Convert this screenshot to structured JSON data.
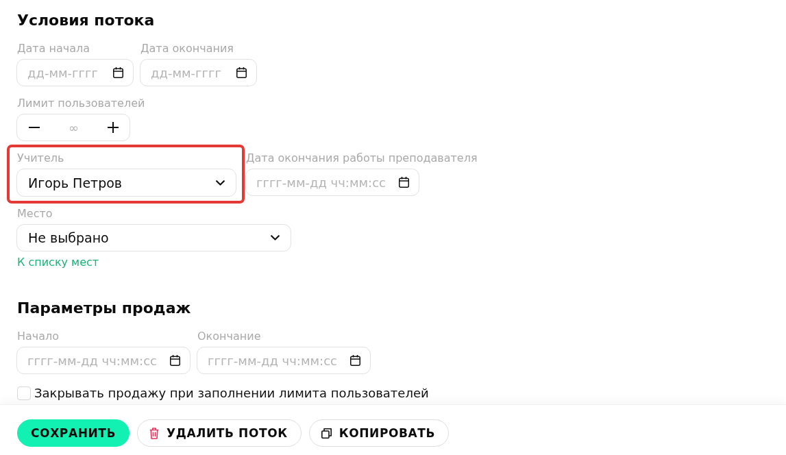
{
  "sections": [
    {
      "title": "Условия потока",
      "rows": [
        {
          "fields": [
            {
              "kind": "date",
              "label": "Дата начала",
              "placeholder": "дд-мм-гггг",
              "highlighted": false
            },
            {
              "kind": "date",
              "label": "Дата окончания",
              "placeholder": "дд-мм-гггг",
              "highlighted": false
            }
          ]
        },
        {
          "fields": [
            {
              "kind": "stepper",
              "label": "Лимит пользователей",
              "placeholder": "∞",
              "highlighted": false
            }
          ]
        },
        {
          "fields": [
            {
              "kind": "select",
              "label": "Учитель",
              "value": "Игорь Петров",
              "highlighted": true
            },
            {
              "kind": "datetime",
              "label": "Дата окончания работы преподавателя",
              "placeholder": "гггг-мм-дд чч:мм:сс",
              "highlighted": false
            }
          ]
        },
        {
          "fields": [
            {
              "kind": "select",
              "label": "Место",
              "value": "Не выбрано",
              "highlighted": false
            }
          ]
        }
      ],
      "link": "К списку мест"
    },
    {
      "title": "Параметры продаж",
      "rows": [
        {
          "fields": [
            {
              "kind": "datetime",
              "label": "Начало",
              "placeholder": "гггг-мм-дд чч:мм:сс",
              "highlighted": false
            },
            {
              "kind": "datetime",
              "label": "Окончание",
              "placeholder": "гггг-мм-дд чч:мм:сс",
              "highlighted": false
            }
          ]
        }
      ],
      "checkbox": {
        "label": "Закрывать продажу при заполнении лимита пользователей",
        "checked": false
      }
    }
  ],
  "buttons": [
    {
      "kind": "save",
      "label": "СОХРАНИТЬ"
    },
    {
      "kind": "delete",
      "label": "УДАЛИТЬ ПОТОК"
    },
    {
      "kind": "copy",
      "label": "КОПИРОВАТЬ"
    }
  ]
}
